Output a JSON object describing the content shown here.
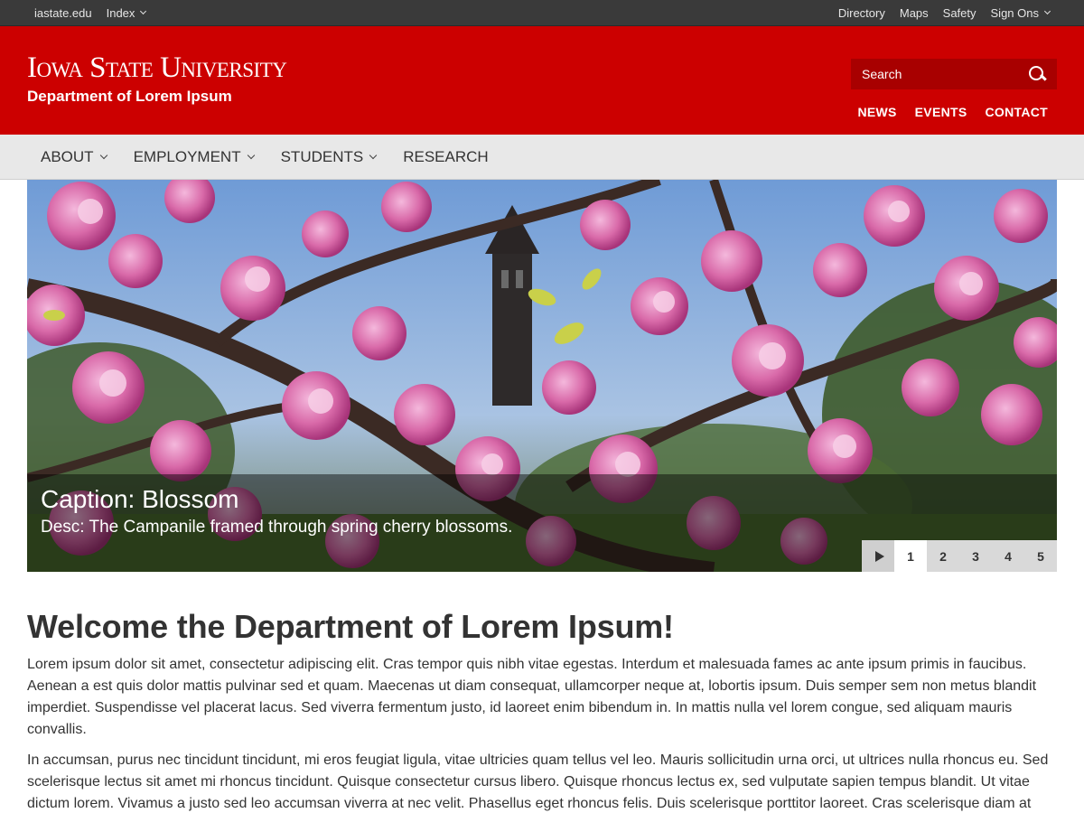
{
  "utility": {
    "left": [
      {
        "label": "iastate.edu",
        "dropdown": false
      },
      {
        "label": "Index",
        "dropdown": true
      }
    ],
    "right": [
      {
        "label": "Directory",
        "dropdown": false
      },
      {
        "label": "Maps",
        "dropdown": false
      },
      {
        "label": "Safety",
        "dropdown": false
      },
      {
        "label": "Sign Ons",
        "dropdown": true
      }
    ]
  },
  "header": {
    "wordmark": "Iowa State University",
    "department": "Department of Lorem Ipsum",
    "search_placeholder": "Search",
    "links": [
      "NEWS",
      "EVENTS",
      "CONTACT"
    ]
  },
  "nav": {
    "items": [
      {
        "label": "About",
        "dropdown": true
      },
      {
        "label": "Employment",
        "dropdown": true
      },
      {
        "label": "Students",
        "dropdown": true
      },
      {
        "label": "Research",
        "dropdown": false
      }
    ]
  },
  "hero": {
    "caption_title": "Caption: Blossom",
    "caption_desc": "Desc: The Campanile framed through spring cherry blossoms.",
    "slides": [
      "1",
      "2",
      "3",
      "4",
      "5"
    ],
    "active_slide": "1"
  },
  "content": {
    "title": "Welcome the Department of Lorem Ipsum!",
    "paragraphs": [
      "Lorem ipsum dolor sit amet, consectetur adipiscing elit. Cras tempor quis nibh vitae egestas. Interdum et malesuada fames ac ante ipsum primis in faucibus. Aenean a est quis dolor mattis pulvinar sed et quam. Maecenas ut diam consequat, ullamcorper neque at, lobortis ipsum. Duis semper sem non metus blandit imperdiet. Suspendisse vel placerat lacus. Sed viverra fermentum justo, id laoreet enim bibendum in. In mattis nulla vel lorem congue, sed aliquam mauris convallis.",
      "In accumsan, purus nec tincidunt tincidunt, mi eros feugiat ligula, vitae ultricies quam tellus vel leo. Mauris sollicitudin urna orci, ut ultrices nulla rhoncus eu. Sed scelerisque lectus sit amet mi rhoncus tincidunt. Quisque consectetur cursus libero. Quisque rhoncus lectus ex, sed vulputate sapien tempus blandit. Ut vitae dictum lorem. Vivamus a justo sed leo accumsan viverra at nec velit. Phasellus eget rhoncus felis. Duis scelerisque porttitor laoreet. Cras scelerisque diam at"
    ]
  },
  "colors": {
    "brand_red": "#cc0000",
    "search_bg": "#a80000",
    "utility_bg": "#3a3a3a",
    "nav_bg": "#e8e8e8"
  }
}
